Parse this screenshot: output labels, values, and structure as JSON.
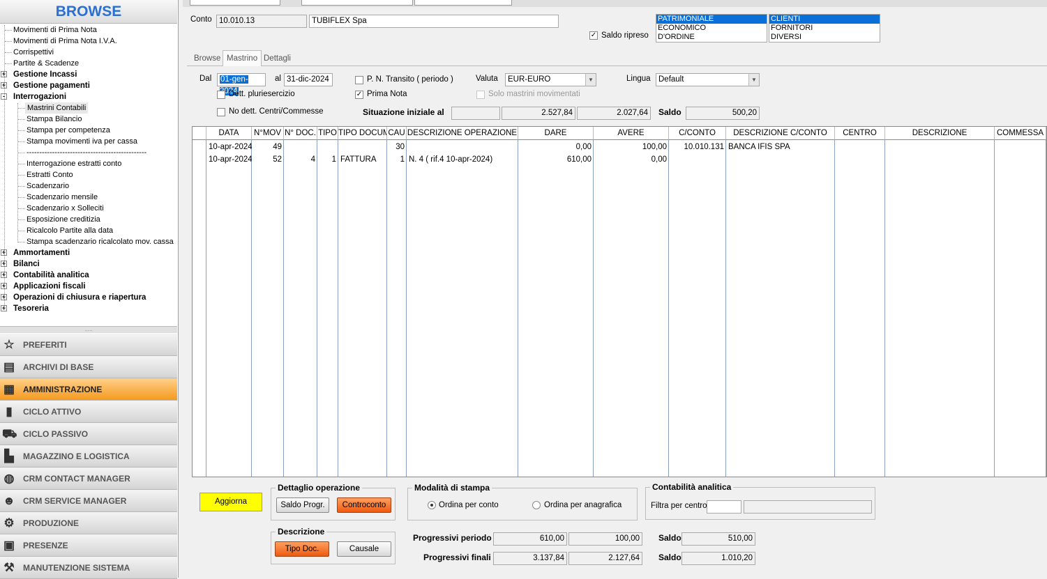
{
  "sidebar": {
    "title": "BROWSE",
    "tree": [
      {
        "label": "Movimenti di Prima Nota",
        "bold": false,
        "level": 1
      },
      {
        "label": "Movimenti di Prima Nota I.V.A.",
        "bold": false,
        "level": 1
      },
      {
        "label": "Corrispettivi",
        "bold": false,
        "level": 1
      },
      {
        "label": "Partite & Scadenze",
        "bold": false,
        "level": 1
      },
      {
        "label": "Gestione Incassi",
        "bold": true,
        "level": 0,
        "expander": "+"
      },
      {
        "label": "Gestione pagamenti",
        "bold": true,
        "level": 0,
        "expander": "+"
      },
      {
        "label": "Interrogazioni",
        "bold": true,
        "level": 0,
        "expander": "-"
      },
      {
        "label": "Mastrini Contabili",
        "bold": false,
        "level": 2,
        "selected": true
      },
      {
        "label": "Stampa Bilancio",
        "bold": false,
        "level": 2
      },
      {
        "label": "Stampa per competenza",
        "bold": false,
        "level": 2
      },
      {
        "label": "Stampa movimenti iva per cassa",
        "bold": false,
        "level": 2
      },
      {
        "label": "-----------------------------------------------",
        "bold": false,
        "level": 2
      },
      {
        "label": "Interrogazione estratti conto",
        "bold": false,
        "level": 2
      },
      {
        "label": "Estratti Conto",
        "bold": false,
        "level": 2
      },
      {
        "label": "Scadenzario",
        "bold": false,
        "level": 2
      },
      {
        "label": "Scadenzario mensile",
        "bold": false,
        "level": 2
      },
      {
        "label": "Scadenzario x Solleciti",
        "bold": false,
        "level": 2
      },
      {
        "label": "Esposizione creditizia",
        "bold": false,
        "level": 2
      },
      {
        "label": "Ricalcolo Partite alla data",
        "bold": false,
        "level": 2
      },
      {
        "label": "Stampa scadenzario ricalcolato mov. cassa",
        "bold": false,
        "level": 2
      },
      {
        "label": "Ammortamenti",
        "bold": true,
        "level": 0,
        "expander": "+"
      },
      {
        "label": "Bilanci",
        "bold": true,
        "level": 0,
        "expander": "+"
      },
      {
        "label": "Contabilità analitica",
        "bold": true,
        "level": 0,
        "expander": "+"
      },
      {
        "label": "Applicazioni fiscali",
        "bold": true,
        "level": 0,
        "expander": "+"
      },
      {
        "label": "Operazioni di chiusura e riapertura",
        "bold": true,
        "level": 0,
        "expander": "+"
      },
      {
        "label": "Tesoreria",
        "bold": true,
        "level": 0,
        "expander": "+"
      }
    ],
    "modules": [
      {
        "label": "PREFERITI",
        "icon": "star-icon",
        "glyph": "☆"
      },
      {
        "label": "ARCHIVI DI BASE",
        "icon": "server-icon",
        "glyph": "▤"
      },
      {
        "label": "AMMINISTRAZIONE",
        "icon": "calculator-icon",
        "glyph": "▦",
        "active": true
      },
      {
        "label": "CICLO ATTIVO",
        "icon": "bar-chart-icon",
        "glyph": "▮"
      },
      {
        "label": "CICLO PASSIVO",
        "icon": "cart-icon",
        "glyph": "⛟"
      },
      {
        "label": "MAGAZZINO E LOGISTICA",
        "icon": "forklift-icon",
        "glyph": "▙"
      },
      {
        "label": "CRM CONTACT MANAGER",
        "icon": "globe-icon",
        "glyph": "◍"
      },
      {
        "label": "CRM SERVICE MANAGER",
        "icon": "people-icon",
        "glyph": "☻"
      },
      {
        "label": "PRODUZIONE",
        "icon": "gear-icon",
        "glyph": "⚙"
      },
      {
        "label": "PRESENZE",
        "icon": "calendar-clock-icon",
        "glyph": "▣"
      },
      {
        "label": "MANUTENZIONE SISTEMA",
        "icon": "wrench-icon",
        "glyph": "⚒"
      }
    ]
  },
  "header": {
    "conto_label": "Conto",
    "conto_code": "10.010.13",
    "conto_name": "TUBIFLEX Spa",
    "saldo_ripreso_label": "Saldo ripreso",
    "saldo_ripreso_checked": true,
    "list1": [
      "PATRIMONIALE",
      "ECONOMICO",
      "D'ORDINE"
    ],
    "list2": [
      "CLIENTI",
      "FORNITORI",
      "DIVERSI"
    ]
  },
  "subtabs": [
    "Browse",
    "Mastrino",
    "Dettagli"
  ],
  "filters": {
    "dal_label": "Dal",
    "dal_value": "01-gen-2024",
    "al_label": "al",
    "al_value": "31-dic-2024",
    "pn_transito_label": "P. N. Transito ( periodo )",
    "valuta_label": "Valuta",
    "valuta_value": "EUR-EURO",
    "lingua_label": "Lingua",
    "lingua_value": "Default",
    "dett_pluriesercizio_label": "Dett. pluriesercizio",
    "prima_nota_label": "Prima  Nota",
    "prima_nota_checked": true,
    "solo_mastrini_label": "Solo mastrini movimentati",
    "no_dett_label": "No dett. Centri/Commesse",
    "situazione_label": "Situazione iniziale al",
    "situazione_date": "",
    "situazione_dare": "2.527,84",
    "situazione_avere": "2.027,64",
    "saldo_label": "Saldo",
    "saldo_value": "500,20"
  },
  "grid": {
    "columns": [
      "DATA",
      "N°MOV",
      "N° DOC.",
      "TIPO",
      "TIPO DOCUM",
      "CAU",
      "DESCRIZIONE OPERAZIONE",
      "DARE",
      "AVERE",
      "C/CONTO",
      "DESCRIZIONE C/CONTO",
      "CENTRO",
      "DESCRIZIONE",
      "COMMESSA"
    ],
    "rows": [
      [
        "10-apr-2024",
        "49",
        "",
        "",
        "",
        "30",
        "",
        "0,00",
        "100,00",
        "10.010.131",
        "BANCA IFIS SPA",
        "",
        "",
        ""
      ],
      [
        "10-apr-2024",
        "52",
        "4",
        "1",
        "FATTURA",
        "1",
        "N. 4 ( rif.4 10-apr-2024)",
        "610,00",
        "0,00",
        "",
        "",
        "",
        "",
        ""
      ]
    ]
  },
  "bottom": {
    "aggiorna_label": "Aggiorna",
    "dettaglio_title": "Dettaglio operazione",
    "saldo_progr_label": "Saldo Progr.",
    "controconto_label": "Controconto",
    "descrizione_title": "Descrizione",
    "tipo_doc_label": "Tipo Doc.",
    "causale_label": "Causale",
    "modalita_title": "Modalità di stampa",
    "ordina_conto_label": "Ordina per conto",
    "ordina_anagrafica_label": "Ordina per anagrafica",
    "analitica_title": "Contabilità analitica",
    "filtra_label": "Filtra per centro:",
    "prog_periodo_label": "Progressivi periodo",
    "prog_periodo_dare": "610,00",
    "prog_periodo_avere": "100,00",
    "prog_periodo_saldo": "510,00",
    "prog_finali_label": "Progressivi finali",
    "prog_finali_dare": "3.137,84",
    "prog_finali_avere": "2.127,64",
    "prog_finali_saldo": "1.010,20",
    "saldo_label": "Saldo"
  },
  "colors": {
    "accent_orange": "#f59a20",
    "browse_blue": "#2a6fd1",
    "selection_blue": "#0a70d8",
    "aggiorna_yellow": "#ffff00"
  }
}
